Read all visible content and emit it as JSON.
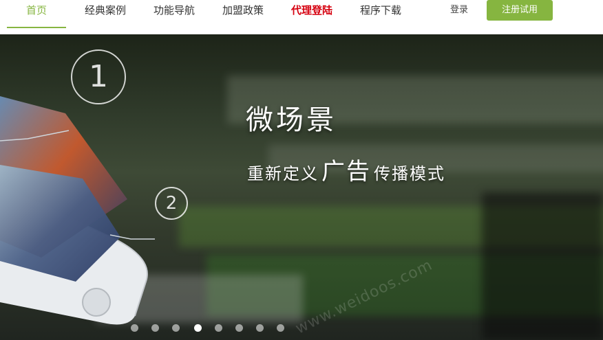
{
  "nav": {
    "items": [
      {
        "label": "首页",
        "state": "active"
      },
      {
        "label": "经典案例",
        "state": ""
      },
      {
        "label": "功能导航",
        "state": ""
      },
      {
        "label": "加盟政策",
        "state": ""
      },
      {
        "label": "代理登陆",
        "state": "highlight"
      },
      {
        "label": "程序下载",
        "state": ""
      }
    ],
    "login": "登录",
    "register": "注册试用"
  },
  "banner": {
    "title": "微场景",
    "subtitle_pre": "重新定义",
    "subtitle_emph": "广告",
    "subtitle_post": "传播模式",
    "step1": "1",
    "step2": "2",
    "watermark": "www.weidoos.com",
    "slide_count": 8,
    "active_slide": 4
  },
  "colors": {
    "accent": "#86b540",
    "highlight": "#d6000f"
  }
}
